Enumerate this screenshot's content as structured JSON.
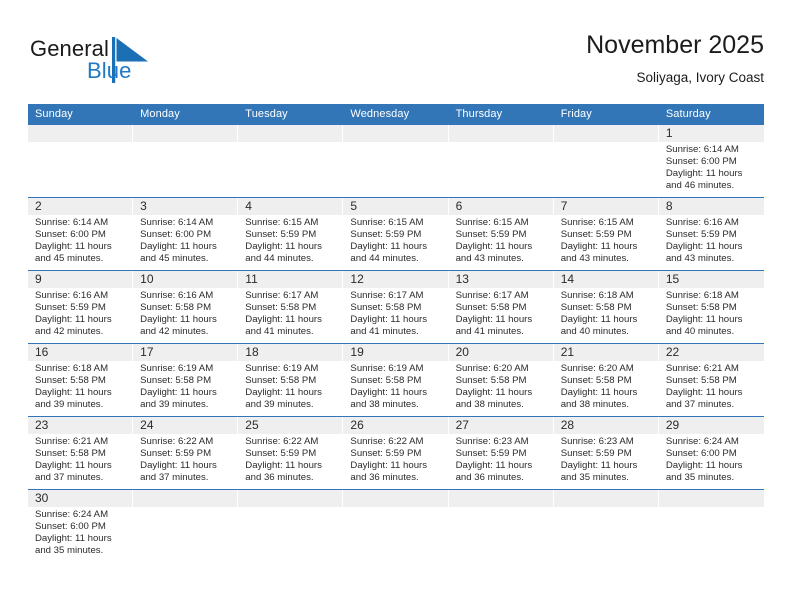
{
  "brand": {
    "name_part1": "General",
    "name_part2": "Blue",
    "flag_color": "#1a6fb5",
    "text_color": "#1a1a1a",
    "blue_color": "#2079c4"
  },
  "header": {
    "title": "November 2025",
    "subtitle": "Soliyaga, Ivory Coast"
  },
  "theme": {
    "header_blue": "#3276b8",
    "daynum_band": "#efefef",
    "row_divider": "#3276b8",
    "text": "#2b2b2b"
  },
  "labels": {
    "sunrise_prefix": "Sunrise:",
    "sunset_prefix": "Sunset:",
    "daylight_prefix": "Daylight:"
  },
  "weekdays": [
    "Sunday",
    "Monday",
    "Tuesday",
    "Wednesday",
    "Thursday",
    "Friday",
    "Saturday"
  ],
  "weeks": [
    [
      {
        "day": ""
      },
      {
        "day": ""
      },
      {
        "day": ""
      },
      {
        "day": ""
      },
      {
        "day": ""
      },
      {
        "day": ""
      },
      {
        "day": "1",
        "sunrise": "Sunrise: 6:14 AM",
        "sunset": "Sunset: 6:00 PM",
        "daylight_line1": "Daylight: 11 hours",
        "daylight_line2": "and 46 minutes."
      }
    ],
    [
      {
        "day": "2",
        "sunrise": "Sunrise: 6:14 AM",
        "sunset": "Sunset: 6:00 PM",
        "daylight_line1": "Daylight: 11 hours",
        "daylight_line2": "and 45 minutes."
      },
      {
        "day": "3",
        "sunrise": "Sunrise: 6:14 AM",
        "sunset": "Sunset: 6:00 PM",
        "daylight_line1": "Daylight: 11 hours",
        "daylight_line2": "and 45 minutes."
      },
      {
        "day": "4",
        "sunrise": "Sunrise: 6:15 AM",
        "sunset": "Sunset: 5:59 PM",
        "daylight_line1": "Daylight: 11 hours",
        "daylight_line2": "and 44 minutes."
      },
      {
        "day": "5",
        "sunrise": "Sunrise: 6:15 AM",
        "sunset": "Sunset: 5:59 PM",
        "daylight_line1": "Daylight: 11 hours",
        "daylight_line2": "and 44 minutes."
      },
      {
        "day": "6",
        "sunrise": "Sunrise: 6:15 AM",
        "sunset": "Sunset: 5:59 PM",
        "daylight_line1": "Daylight: 11 hours",
        "daylight_line2": "and 43 minutes."
      },
      {
        "day": "7",
        "sunrise": "Sunrise: 6:15 AM",
        "sunset": "Sunset: 5:59 PM",
        "daylight_line1": "Daylight: 11 hours",
        "daylight_line2": "and 43 minutes."
      },
      {
        "day": "8",
        "sunrise": "Sunrise: 6:16 AM",
        "sunset": "Sunset: 5:59 PM",
        "daylight_line1": "Daylight: 11 hours",
        "daylight_line2": "and 43 minutes."
      }
    ],
    [
      {
        "day": "9",
        "sunrise": "Sunrise: 6:16 AM",
        "sunset": "Sunset: 5:59 PM",
        "daylight_line1": "Daylight: 11 hours",
        "daylight_line2": "and 42 minutes."
      },
      {
        "day": "10",
        "sunrise": "Sunrise: 6:16 AM",
        "sunset": "Sunset: 5:58 PM",
        "daylight_line1": "Daylight: 11 hours",
        "daylight_line2": "and 42 minutes."
      },
      {
        "day": "11",
        "sunrise": "Sunrise: 6:17 AM",
        "sunset": "Sunset: 5:58 PM",
        "daylight_line1": "Daylight: 11 hours",
        "daylight_line2": "and 41 minutes."
      },
      {
        "day": "12",
        "sunrise": "Sunrise: 6:17 AM",
        "sunset": "Sunset: 5:58 PM",
        "daylight_line1": "Daylight: 11 hours",
        "daylight_line2": "and 41 minutes."
      },
      {
        "day": "13",
        "sunrise": "Sunrise: 6:17 AM",
        "sunset": "Sunset: 5:58 PM",
        "daylight_line1": "Daylight: 11 hours",
        "daylight_line2": "and 41 minutes."
      },
      {
        "day": "14",
        "sunrise": "Sunrise: 6:18 AM",
        "sunset": "Sunset: 5:58 PM",
        "daylight_line1": "Daylight: 11 hours",
        "daylight_line2": "and 40 minutes."
      },
      {
        "day": "15",
        "sunrise": "Sunrise: 6:18 AM",
        "sunset": "Sunset: 5:58 PM",
        "daylight_line1": "Daylight: 11 hours",
        "daylight_line2": "and 40 minutes."
      }
    ],
    [
      {
        "day": "16",
        "sunrise": "Sunrise: 6:18 AM",
        "sunset": "Sunset: 5:58 PM",
        "daylight_line1": "Daylight: 11 hours",
        "daylight_line2": "and 39 minutes."
      },
      {
        "day": "17",
        "sunrise": "Sunrise: 6:19 AM",
        "sunset": "Sunset: 5:58 PM",
        "daylight_line1": "Daylight: 11 hours",
        "daylight_line2": "and 39 minutes."
      },
      {
        "day": "18",
        "sunrise": "Sunrise: 6:19 AM",
        "sunset": "Sunset: 5:58 PM",
        "daylight_line1": "Daylight: 11 hours",
        "daylight_line2": "and 39 minutes."
      },
      {
        "day": "19",
        "sunrise": "Sunrise: 6:19 AM",
        "sunset": "Sunset: 5:58 PM",
        "daylight_line1": "Daylight: 11 hours",
        "daylight_line2": "and 38 minutes."
      },
      {
        "day": "20",
        "sunrise": "Sunrise: 6:20 AM",
        "sunset": "Sunset: 5:58 PM",
        "daylight_line1": "Daylight: 11 hours",
        "daylight_line2": "and 38 minutes."
      },
      {
        "day": "21",
        "sunrise": "Sunrise: 6:20 AM",
        "sunset": "Sunset: 5:58 PM",
        "daylight_line1": "Daylight: 11 hours",
        "daylight_line2": "and 38 minutes."
      },
      {
        "day": "22",
        "sunrise": "Sunrise: 6:21 AM",
        "sunset": "Sunset: 5:58 PM",
        "daylight_line1": "Daylight: 11 hours",
        "daylight_line2": "and 37 minutes."
      }
    ],
    [
      {
        "day": "23",
        "sunrise": "Sunrise: 6:21 AM",
        "sunset": "Sunset: 5:58 PM",
        "daylight_line1": "Daylight: 11 hours",
        "daylight_line2": "and 37 minutes."
      },
      {
        "day": "24",
        "sunrise": "Sunrise: 6:22 AM",
        "sunset": "Sunset: 5:59 PM",
        "daylight_line1": "Daylight: 11 hours",
        "daylight_line2": "and 37 minutes."
      },
      {
        "day": "25",
        "sunrise": "Sunrise: 6:22 AM",
        "sunset": "Sunset: 5:59 PM",
        "daylight_line1": "Daylight: 11 hours",
        "daylight_line2": "and 36 minutes."
      },
      {
        "day": "26",
        "sunrise": "Sunrise: 6:22 AM",
        "sunset": "Sunset: 5:59 PM",
        "daylight_line1": "Daylight: 11 hours",
        "daylight_line2": "and 36 minutes."
      },
      {
        "day": "27",
        "sunrise": "Sunrise: 6:23 AM",
        "sunset": "Sunset: 5:59 PM",
        "daylight_line1": "Daylight: 11 hours",
        "daylight_line2": "and 36 minutes."
      },
      {
        "day": "28",
        "sunrise": "Sunrise: 6:23 AM",
        "sunset": "Sunset: 5:59 PM",
        "daylight_line1": "Daylight: 11 hours",
        "daylight_line2": "and 35 minutes."
      },
      {
        "day": "29",
        "sunrise": "Sunrise: 6:24 AM",
        "sunset": "Sunset: 6:00 PM",
        "daylight_line1": "Daylight: 11 hours",
        "daylight_line2": "and 35 minutes."
      }
    ],
    [
      {
        "day": "30",
        "sunrise": "Sunrise: 6:24 AM",
        "sunset": "Sunset: 6:00 PM",
        "daylight_line1": "Daylight: 11 hours",
        "daylight_line2": "and 35 minutes."
      },
      {
        "day": ""
      },
      {
        "day": ""
      },
      {
        "day": ""
      },
      {
        "day": ""
      },
      {
        "day": ""
      },
      {
        "day": ""
      }
    ]
  ]
}
